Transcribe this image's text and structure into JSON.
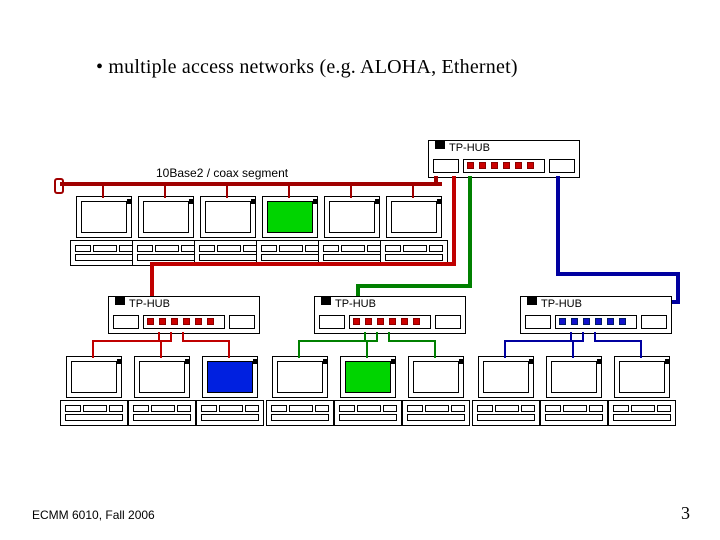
{
  "bullet_text": "• multiple access networks (e.g. ALOHA, Ethernet)",
  "segment_label": "10Base2 / coax segment",
  "hub_label": "TP-HUB",
  "footer_left": "ECMM 6010, Fall 2006",
  "footer_right": "3",
  "colors": {
    "coax": "#a00000",
    "mid_link": "#008000",
    "right_link": "#0000a0"
  },
  "top_row_pc_count": 6,
  "top_green_index": 3,
  "hubs": [
    {
      "name": "left",
      "ports": 6,
      "style": "red"
    },
    {
      "name": "mid",
      "ports": 6,
      "style": "red"
    },
    {
      "name": "right",
      "ports": 6,
      "style": "blue"
    },
    {
      "name": "top",
      "ports": 6,
      "style": "red"
    }
  ],
  "bottom_groups": [
    {
      "count": 3,
      "special": {
        "index": 2,
        "class": "blue"
      }
    },
    {
      "count": 3,
      "special": {
        "index": 1,
        "class": "green"
      }
    },
    {
      "count": 3,
      "special": null
    }
  ]
}
